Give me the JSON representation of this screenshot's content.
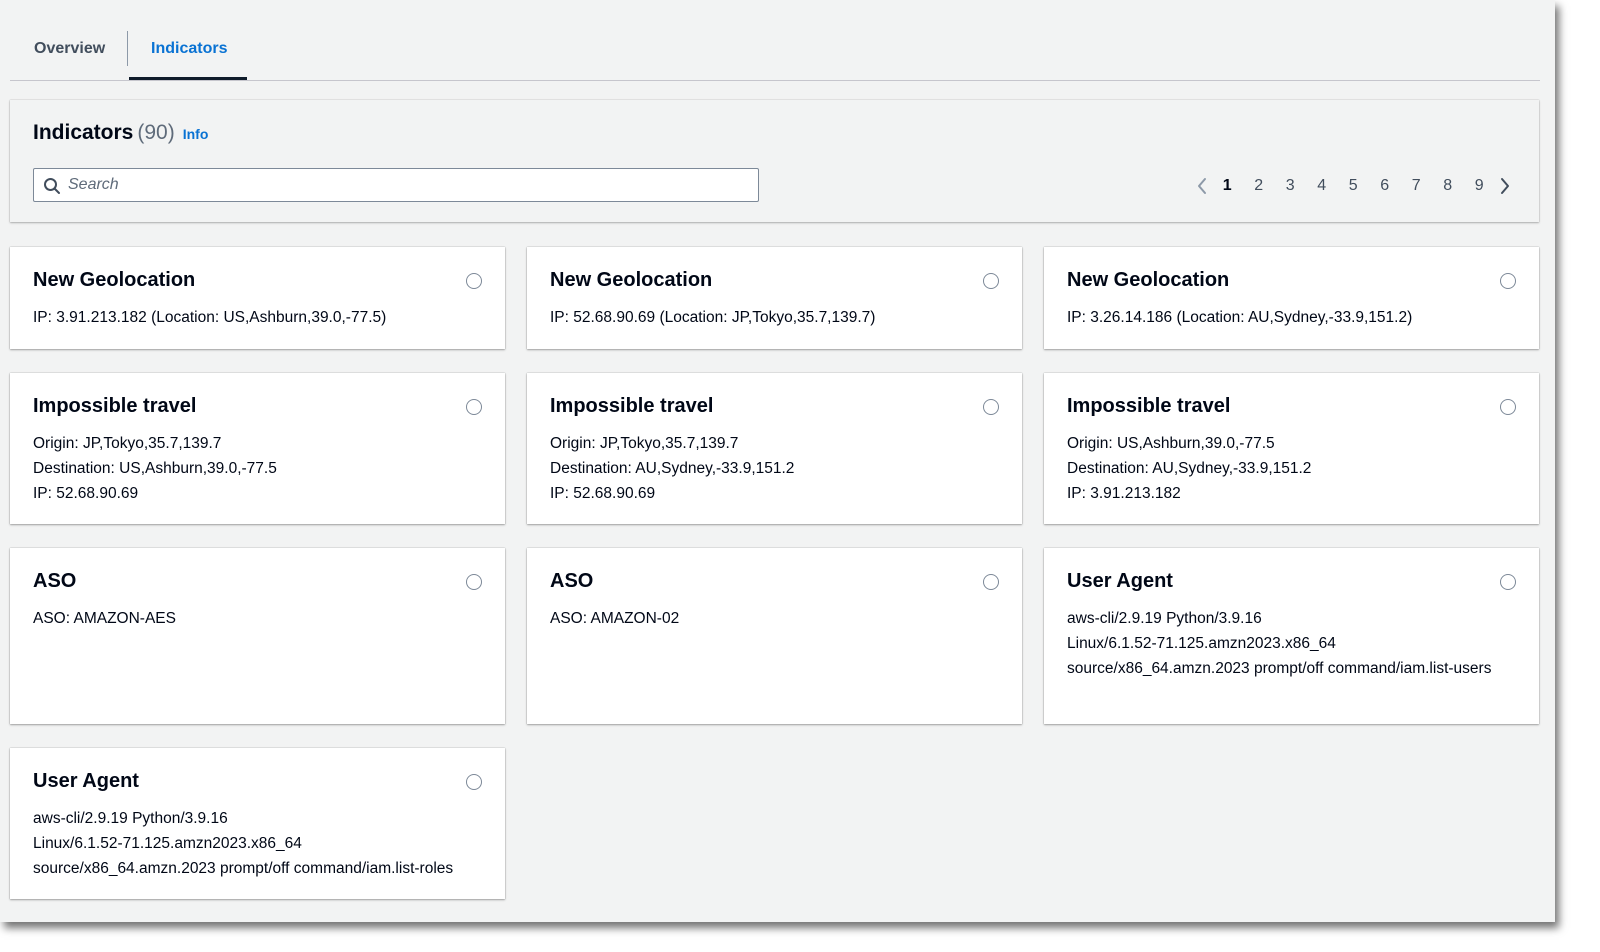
{
  "tabs": [
    {
      "label": "Overview",
      "active": false
    },
    {
      "label": "Indicators",
      "active": true
    }
  ],
  "header": {
    "title": "Indicators",
    "count": "(90)",
    "info_link": "Info"
  },
  "search": {
    "placeholder": "Search",
    "value": ""
  },
  "pagination": {
    "pages": [
      "1",
      "2",
      "3",
      "4",
      "5",
      "6",
      "7",
      "8",
      "9"
    ],
    "current": "1"
  },
  "colors": {
    "accent": "#0972d3",
    "background": "#f2f3f3",
    "card": "#ffffff",
    "text": "#000716"
  },
  "icons": {
    "search": "search-icon",
    "prev": "chevron-left-icon",
    "next": "chevron-right-icon"
  },
  "cards": [
    {
      "title": "New Geolocation",
      "lines": [
        "IP: 3.91.213.182 (Location: US,Ashburn,39.0,-77.5)"
      ]
    },
    {
      "title": "New Geolocation",
      "lines": [
        "IP: 52.68.90.69 (Location: JP,Tokyo,35.7,139.7)"
      ]
    },
    {
      "title": "New Geolocation",
      "lines": [
        "IP: 3.26.14.186 (Location: AU,Sydney,-33.9,151.2)"
      ]
    },
    {
      "title": "Impossible travel",
      "lines": [
        "Origin: JP,Tokyo,35.7,139.7",
        "Destination: US,Ashburn,39.0,-77.5",
        "IP: 52.68.90.69"
      ]
    },
    {
      "title": "Impossible travel",
      "lines": [
        "Origin: JP,Tokyo,35.7,139.7",
        "Destination: AU,Sydney,-33.9,151.2",
        "IP: 52.68.90.69"
      ]
    },
    {
      "title": "Impossible travel",
      "lines": [
        "Origin: US,Ashburn,39.0,-77.5",
        "Destination: AU,Sydney,-33.9,151.2",
        "IP: 3.91.213.182"
      ]
    },
    {
      "title": "ASO",
      "lines": [
        "ASO: AMAZON-AES"
      ]
    },
    {
      "title": "ASO",
      "lines": [
        "ASO: AMAZON-02"
      ]
    },
    {
      "title": "User Agent",
      "lines": [
        "aws-cli/2.9.19 Python/3.9.16",
        "Linux/6.1.52-71.125.amzn2023.x86_64",
        "source/x86_64.amzn.2023 prompt/off command/iam.list-users"
      ]
    },
    {
      "title": "User Agent",
      "lines": [
        "aws-cli/2.9.19 Python/3.9.16",
        "Linux/6.1.52-71.125.amzn2023.x86_64",
        "source/x86_64.amzn.2023 prompt/off command/iam.list-roles"
      ]
    }
  ]
}
